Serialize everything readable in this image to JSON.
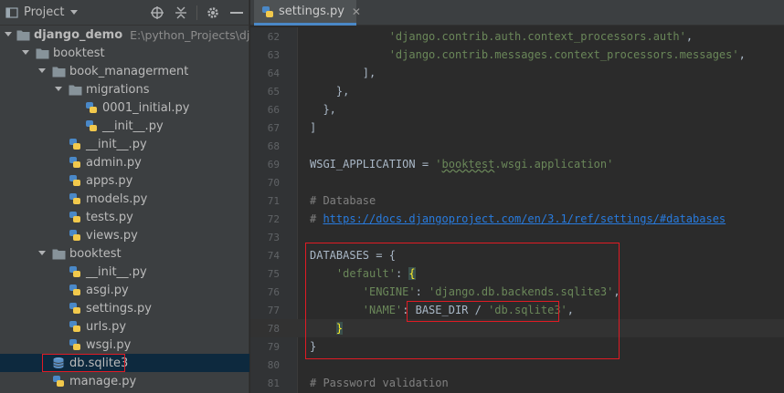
{
  "project_panel": {
    "title": "Project",
    "tree": [
      {
        "label": "django_demo",
        "path": "E:\\python_Projects\\django",
        "depth": 0,
        "type": "folder",
        "expanded": true,
        "bold": true
      },
      {
        "label": "booktest",
        "depth": 1,
        "type": "folder",
        "expanded": true
      },
      {
        "label": "book_managerment",
        "depth": 2,
        "type": "folder",
        "expanded": true
      },
      {
        "label": "migrations",
        "depth": 3,
        "type": "folder",
        "expanded": true
      },
      {
        "label": "0001_initial.py",
        "depth": 4,
        "type": "py"
      },
      {
        "label": "__init__.py",
        "depth": 4,
        "type": "py"
      },
      {
        "label": "__init__.py",
        "depth": 3,
        "type": "py"
      },
      {
        "label": "admin.py",
        "depth": 3,
        "type": "py"
      },
      {
        "label": "apps.py",
        "depth": 3,
        "type": "py"
      },
      {
        "label": "models.py",
        "depth": 3,
        "type": "py"
      },
      {
        "label": "tests.py",
        "depth": 3,
        "type": "py"
      },
      {
        "label": "views.py",
        "depth": 3,
        "type": "py"
      },
      {
        "label": "booktest",
        "depth": 2,
        "type": "folder",
        "expanded": true
      },
      {
        "label": "__init__.py",
        "depth": 3,
        "type": "py"
      },
      {
        "label": "asgi.py",
        "depth": 3,
        "type": "py"
      },
      {
        "label": "settings.py",
        "depth": 3,
        "type": "py"
      },
      {
        "label": "urls.py",
        "depth": 3,
        "type": "py"
      },
      {
        "label": "wsgi.py",
        "depth": 3,
        "type": "py"
      },
      {
        "label": "db.sqlite3",
        "depth": 2,
        "type": "db",
        "selected": true
      },
      {
        "label": "manage.py",
        "depth": 2,
        "type": "py"
      }
    ]
  },
  "editor": {
    "tab_label": "settings.py",
    "lines": [
      {
        "n": "62",
        "html": "            <span class='s'>'django.contrib.auth.context_processors.auth'</span>,"
      },
      {
        "n": "63",
        "html": "            <span class='s'>'django.contrib.messages.context_processors.messages'</span>,"
      },
      {
        "n": "64",
        "html": "        ],"
      },
      {
        "n": "65",
        "html": "    },"
      },
      {
        "n": "66",
        "html": "  },"
      },
      {
        "n": "67",
        "html": "]"
      },
      {
        "n": "68",
        "html": ""
      },
      {
        "n": "69",
        "html": "WSGI_APPLICATION = <span class='s'>'<span class='wavy'>booktest</span>.wsgi.application'</span>"
      },
      {
        "n": "70",
        "html": ""
      },
      {
        "n": "71",
        "html": "<span class='c'># Database</span>"
      },
      {
        "n": "72",
        "html": "<span class='c'># <span class='u'>https://docs.djangoproject.com/en/3.1/ref/settings/#databases</span></span>"
      },
      {
        "n": "73",
        "html": ""
      },
      {
        "n": "74",
        "html": "DATABASES = {"
      },
      {
        "n": "75",
        "html": "    <span class='s'>'default'</span>: <span class='hl-brace'>{</span>"
      },
      {
        "n": "76",
        "html": "        <span class='s'>'ENGINE'</span>: <span class='s'>'django.db.backends.sqlite3'</span>,"
      },
      {
        "n": "77",
        "html": "        <span class='s'>'NAME'</span>: BASE_DIR / <span class='s'>'db.sqlite3'</span>,"
      },
      {
        "n": "78",
        "html": "    <span class='hl-brace'>}</span>"
      },
      {
        "n": "79",
        "html": "}"
      },
      {
        "n": "80",
        "html": ""
      },
      {
        "n": "81",
        "html": "<span class='c'># Password validation</span>"
      }
    ]
  }
}
